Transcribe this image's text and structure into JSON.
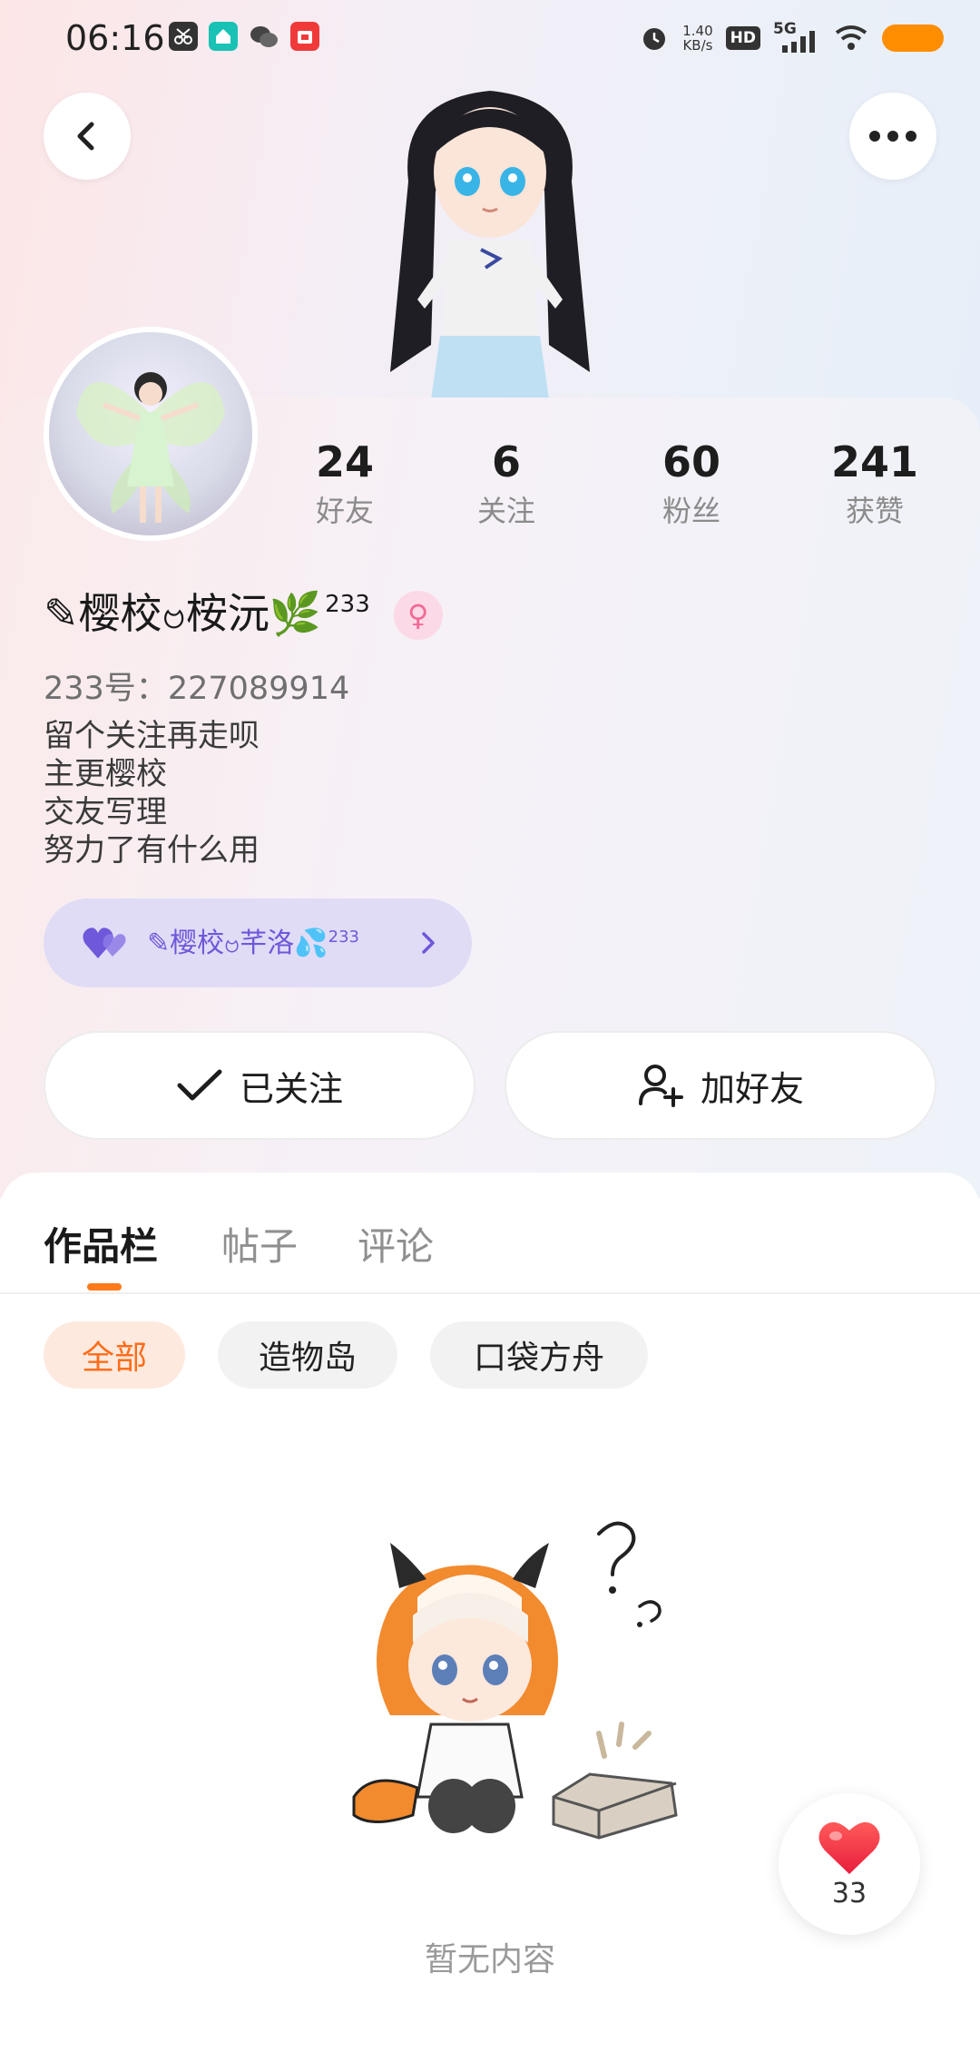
{
  "status_bar": {
    "time": "06:16",
    "net_speed_value": "1.40",
    "net_speed_unit": "KB/s",
    "hd_label": "HD",
    "network": "5G",
    "battery_color": "#ff8d00",
    "app_icons": [
      "scissors-app-icon",
      "home-app-icon",
      "wechat-icon",
      "shopping-app-icon"
    ]
  },
  "header": {
    "back_icon": "chevron-left-icon",
    "more_icon": "more-dots-icon"
  },
  "profile": {
    "stats": [
      {
        "value": "24",
        "label": "好友"
      },
      {
        "value": "6",
        "label": "关注"
      },
      {
        "value": "60",
        "label": "粉丝"
      },
      {
        "value": "241",
        "label": "获赞"
      }
    ],
    "nickname": "✎樱校ဗ桉沅🌿",
    "nickname_sup": "233",
    "gender_icon": "female-icon",
    "uid_label": "233号：",
    "uid": "227089914",
    "bio_lines": [
      "留个关注再走呗",
      "主更樱校",
      "交友写理",
      "努力了有什么用"
    ],
    "companion": {
      "name": "✎樱校ဗ芊洛💦",
      "name_sup": "233",
      "accent": "#6f58d9"
    }
  },
  "actions": {
    "follow_label": "已关注",
    "add_friend_label": "加好友"
  },
  "tabs": [
    {
      "label": "作品栏",
      "active": true
    },
    {
      "label": "帖子",
      "active": false
    },
    {
      "label": "评论",
      "active": false
    }
  ],
  "filters": [
    {
      "label": "全部",
      "active": true
    },
    {
      "label": "造物岛",
      "active": false
    },
    {
      "label": "口袋方舟",
      "active": false
    }
  ],
  "accent_color": "#ff7a1a",
  "empty_state": {
    "text": "暂无内容"
  },
  "like_bubble": {
    "count": "33",
    "icon": "heart-icon"
  }
}
